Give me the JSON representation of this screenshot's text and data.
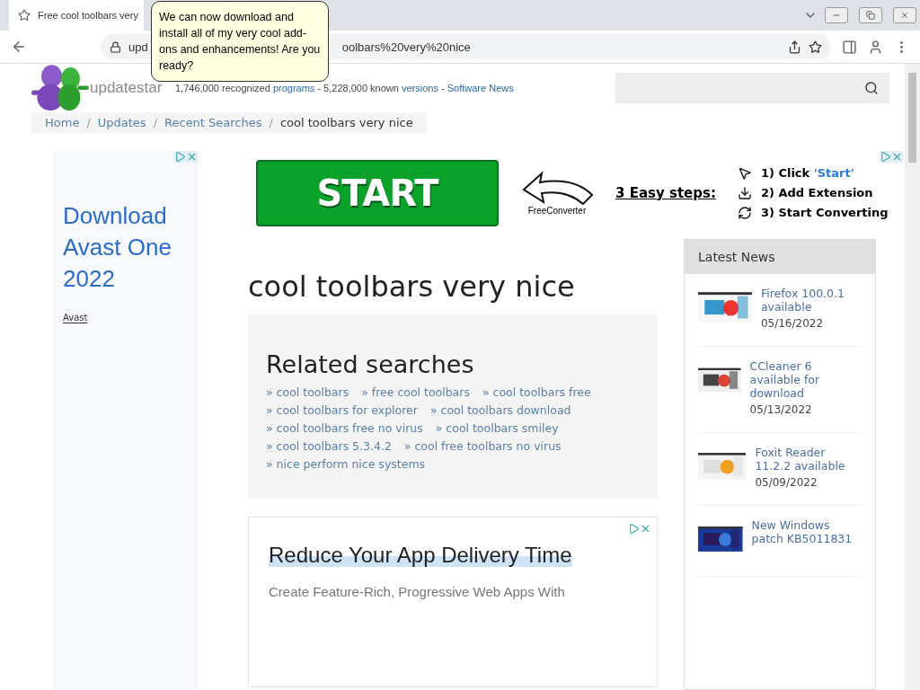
{
  "browser": {
    "tab_title": "Free cool toolbars very",
    "address_start": "upd",
    "address_end": "oolbars%20very%20nice"
  },
  "assistant": {
    "speech": "We can now download and install all of my very cool add-ons and enhancements! Are you ready?"
  },
  "site": {
    "logo": "updatestar",
    "stats": [
      {
        "text": "1,746,000 recognized ",
        "kind": "plain"
      },
      {
        "text": "programs",
        "kind": "link"
      },
      {
        "text": " - 5,228,000 known ",
        "kind": "plain"
      },
      {
        "text": "versions",
        "kind": "link"
      },
      {
        "text": " - ",
        "kind": "plain"
      },
      {
        "text": "Software News",
        "kind": "link"
      }
    ]
  },
  "breadcrumb_separator": "/",
  "breadcrumb": [
    {
      "label": "Home",
      "current": false
    },
    {
      "label": "Updates",
      "current": false
    },
    {
      "label": "Recent Searches",
      "current": false
    },
    {
      "label": "cool toolbars very nice",
      "current": true
    }
  ],
  "left_ad": {
    "headline": "Download Avast One 2022",
    "advertiser": "Avast"
  },
  "banner_ad": {
    "button": "START",
    "brand": "FreeConverter",
    "steps_title": "3 Easy steps:",
    "steps": [
      {
        "kind": "pointer",
        "text": "1) Click ",
        "highlight": "'Start'"
      },
      {
        "kind": "download",
        "text": "2) Add Extension"
      },
      {
        "kind": "refresh",
        "text": "3) Start Converting"
      }
    ]
  },
  "page_title": "cool toolbars very nice",
  "related": {
    "title": "Related searches",
    "rows": [
      [
        "» cool toolbars",
        "» free cool toolbars",
        "» cool toolbars free"
      ],
      [
        "» cool toolbars for explorer",
        "» cool toolbars download"
      ],
      [
        "» cool toolbars free no virus",
        "» cool toolbars smiley"
      ],
      [
        "» cool toolbars 5.3.4.2",
        "» cool free toolbars no virus"
      ],
      [
        "» nice perform nice systems"
      ]
    ]
  },
  "content_ad": {
    "headline": "Reduce Your App Delivery Time",
    "body": "Create Feature-Rich, Progressive Web Apps With"
  },
  "latest_news": {
    "title": "Latest News",
    "items": [
      {
        "title": "Firefox 100.0.1 available",
        "date": "05/16/2022"
      },
      {
        "title": "CCleaner 6 available for download",
        "date": "05/13/2022"
      },
      {
        "title": "Foxit Reader 11.2.2 available",
        "date": "05/09/2022"
      },
      {
        "title": "New Windows patch KB5011831"
      }
    ]
  }
}
